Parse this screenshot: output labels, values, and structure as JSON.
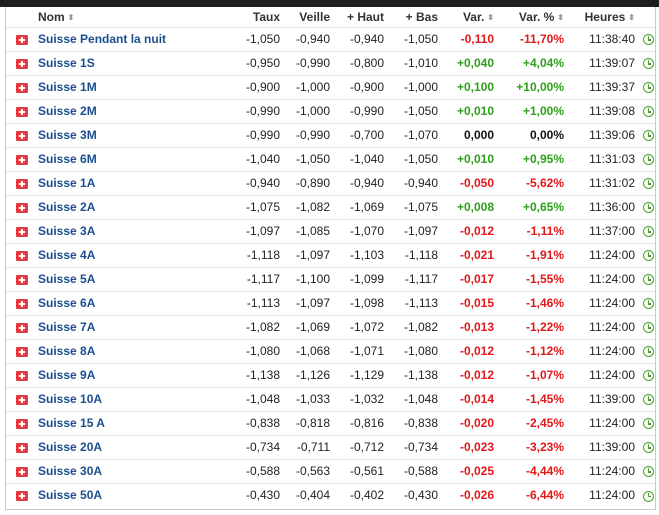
{
  "header": {
    "nom": "Nom",
    "taux": "Taux",
    "veille": "Veille",
    "haut": "+ Haut",
    "bas": "+ Bas",
    "var": "Var.",
    "var_pct": "Var. %",
    "heures": "Heures",
    "sort_glyph": "⬍"
  },
  "colors": {
    "positive": "#2ea01c",
    "negative": "#e01818",
    "link": "#1a4f8f",
    "flag": "#e23b3b",
    "clock": "#4aa02c"
  },
  "rows": [
    {
      "name": "Suisse Pendant la nuit",
      "taux": "-1,050",
      "veille": "-0,940",
      "haut": "-0,940",
      "bas": "-1,050",
      "var": "-0,110",
      "var_pct": "-11,70%",
      "time": "11:38:40",
      "dir": "neg"
    },
    {
      "name": "Suisse 1S",
      "taux": "-0,950",
      "veille": "-0,990",
      "haut": "-0,800",
      "bas": "-1,010",
      "var": "+0,040",
      "var_pct": "+4,04%",
      "time": "11:39:07",
      "dir": "pos"
    },
    {
      "name": "Suisse 1M",
      "taux": "-0,900",
      "veille": "-1,000",
      "haut": "-0,900",
      "bas": "-1,000",
      "var": "+0,100",
      "var_pct": "+10,00%",
      "time": "11:39:37",
      "dir": "pos"
    },
    {
      "name": "Suisse 2M",
      "taux": "-0,990",
      "veille": "-1,000",
      "haut": "-0,990",
      "bas": "-1,050",
      "var": "+0,010",
      "var_pct": "+1,00%",
      "time": "11:39:08",
      "dir": "pos"
    },
    {
      "name": "Suisse 3M",
      "taux": "-0,990",
      "veille": "-0,990",
      "haut": "-0,700",
      "bas": "-1,070",
      "var": "0,000",
      "var_pct": "0,00%",
      "time": "11:39:06",
      "dir": "zero"
    },
    {
      "name": "Suisse 6M",
      "taux": "-1,040",
      "veille": "-1,050",
      "haut": "-1,040",
      "bas": "-1,050",
      "var": "+0,010",
      "var_pct": "+0,95%",
      "time": "11:31:03",
      "dir": "pos"
    },
    {
      "name": "Suisse 1A",
      "taux": "-0,940",
      "veille": "-0,890",
      "haut": "-0,940",
      "bas": "-0,940",
      "var": "-0,050",
      "var_pct": "-5,62%",
      "time": "11:31:02",
      "dir": "neg"
    },
    {
      "name": "Suisse 2A",
      "taux": "-1,075",
      "veille": "-1,082",
      "haut": "-1,069",
      "bas": "-1,075",
      "var": "+0,008",
      "var_pct": "+0,65%",
      "time": "11:36:00",
      "dir": "pos"
    },
    {
      "name": "Suisse 3A",
      "taux": "-1,097",
      "veille": "-1,085",
      "haut": "-1,070",
      "bas": "-1,097",
      "var": "-0,012",
      "var_pct": "-1,11%",
      "time": "11:37:00",
      "dir": "neg"
    },
    {
      "name": "Suisse 4A",
      "taux": "-1,118",
      "veille": "-1,097",
      "haut": "-1,103",
      "bas": "-1,118",
      "var": "-0,021",
      "var_pct": "-1,91%",
      "time": "11:24:00",
      "dir": "neg"
    },
    {
      "name": "Suisse 5A",
      "taux": "-1,117",
      "veille": "-1,100",
      "haut": "-1,099",
      "bas": "-1,117",
      "var": "-0,017",
      "var_pct": "-1,55%",
      "time": "11:24:00",
      "dir": "neg"
    },
    {
      "name": "Suisse 6A",
      "taux": "-1,113",
      "veille": "-1,097",
      "haut": "-1,098",
      "bas": "-1,113",
      "var": "-0,015",
      "var_pct": "-1,46%",
      "time": "11:24:00",
      "dir": "neg"
    },
    {
      "name": "Suisse 7A",
      "taux": "-1,082",
      "veille": "-1,069",
      "haut": "-1,072",
      "bas": "-1,082",
      "var": "-0,013",
      "var_pct": "-1,22%",
      "time": "11:24:00",
      "dir": "neg"
    },
    {
      "name": "Suisse 8A",
      "taux": "-1,080",
      "veille": "-1,068",
      "haut": "-1,071",
      "bas": "-1,080",
      "var": "-0,012",
      "var_pct": "-1,12%",
      "time": "11:24:00",
      "dir": "neg"
    },
    {
      "name": "Suisse 9A",
      "taux": "-1,138",
      "veille": "-1,126",
      "haut": "-1,129",
      "bas": "-1,138",
      "var": "-0,012",
      "var_pct": "-1,07%",
      "time": "11:24:00",
      "dir": "neg"
    },
    {
      "name": "Suisse 10A",
      "taux": "-1,048",
      "veille": "-1,033",
      "haut": "-1,032",
      "bas": "-1,048",
      "var": "-0,014",
      "var_pct": "-1,45%",
      "time": "11:39:00",
      "dir": "neg"
    },
    {
      "name": "Suisse 15 A",
      "taux": "-0,838",
      "veille": "-0,818",
      "haut": "-0,816",
      "bas": "-0,838",
      "var": "-0,020",
      "var_pct": "-2,45%",
      "time": "11:24:00",
      "dir": "neg"
    },
    {
      "name": "Suisse 20A",
      "taux": "-0,734",
      "veille": "-0,711",
      "haut": "-0,712",
      "bas": "-0,734",
      "var": "-0,023",
      "var_pct": "-3,23%",
      "time": "11:39:00",
      "dir": "neg"
    },
    {
      "name": "Suisse 30A",
      "taux": "-0,588",
      "veille": "-0,563",
      "haut": "-0,561",
      "bas": "-0,588",
      "var": "-0,025",
      "var_pct": "-4,44%",
      "time": "11:24:00",
      "dir": "neg"
    },
    {
      "name": "Suisse 50A",
      "taux": "-0,430",
      "veille": "-0,404",
      "haut": "-0,402",
      "bas": "-0,430",
      "var": "-0,026",
      "var_pct": "-6,44%",
      "time": "11:24:00",
      "dir": "neg"
    }
  ]
}
